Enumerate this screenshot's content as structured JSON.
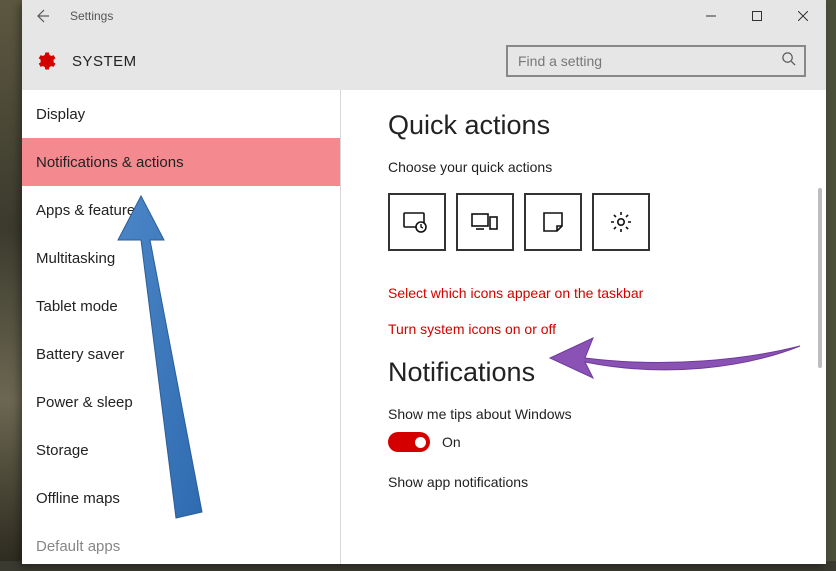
{
  "window": {
    "title": "Settings",
    "section": "SYSTEM"
  },
  "search": {
    "placeholder": "Find a setting"
  },
  "sidebar": {
    "items": [
      {
        "label": "Display",
        "active": false
      },
      {
        "label": "Notifications & actions",
        "active": true
      },
      {
        "label": "Apps & features",
        "active": false
      },
      {
        "label": "Multitasking",
        "active": false
      },
      {
        "label": "Tablet mode",
        "active": false
      },
      {
        "label": "Battery saver",
        "active": false
      },
      {
        "label": "Power & sleep",
        "active": false
      },
      {
        "label": "Storage",
        "active": false
      },
      {
        "label": "Offline maps",
        "active": false
      },
      {
        "label": "Default apps",
        "active": false
      }
    ]
  },
  "content": {
    "quick_actions_heading": "Quick actions",
    "quick_actions_sub": "Choose your quick actions",
    "tiles": [
      {
        "name": "tablet-mode-tile"
      },
      {
        "name": "connect-tile"
      },
      {
        "name": "note-tile"
      },
      {
        "name": "all-settings-tile"
      }
    ],
    "link_taskbar": "Select which icons appear on the taskbar",
    "link_system_icons": "Turn system icons on or off",
    "notifications_heading": "Notifications",
    "toggle_tips_label": "Show me tips about Windows",
    "toggle_tips_state": "On",
    "toggle_app_label": "Show app notifications"
  }
}
